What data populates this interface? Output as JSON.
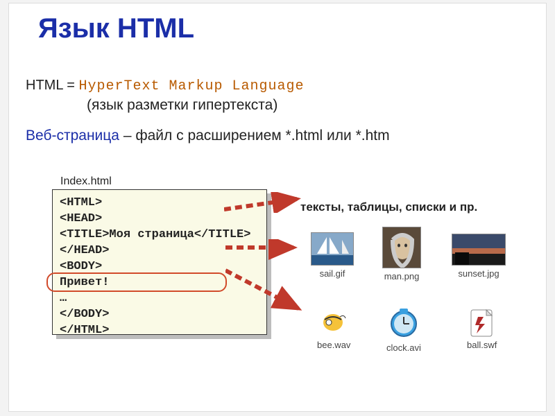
{
  "title": "Язык HTML",
  "line1_label": "HTML =",
  "line1_expansion": "HyperText Markup Language",
  "line2": "(язык разметки гипертекста)",
  "line3_webpage": "Веб-страница",
  "line3_rest": " – файл с расширением *.html или *.htm",
  "index_label": "Index.html",
  "code": {
    "l1": "<HTML>",
    "l2": "<HEAD>",
    "l3": "<TITLE>Моя страница</TITLE>",
    "l4": "</HEAD>",
    "l5": "<BODY>",
    "l6": "Привет!",
    "l7": "…",
    "l8": "</BODY>",
    "l9": "</HTML>"
  },
  "list_label": "тексты, таблицы, списки и пр.",
  "thumbs": {
    "sail": "sail.gif",
    "man": "man.png",
    "sunset": "sunset.jpg",
    "bee": "bee.wav",
    "clock": "clock.avi",
    "ball": "ball.swf"
  }
}
